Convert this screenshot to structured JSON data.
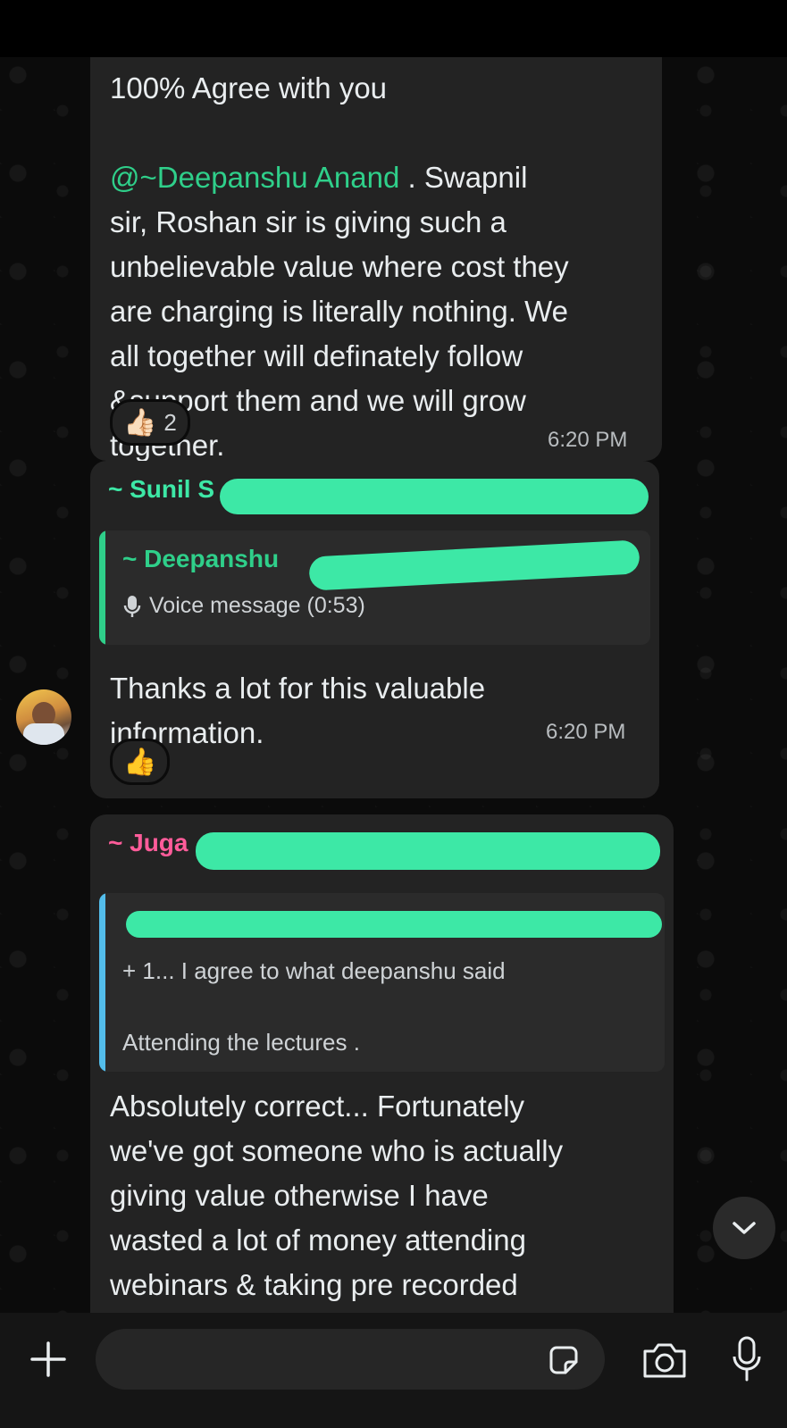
{
  "messages": [
    {
      "text_prefix": "100% Agree with you",
      "mention": "@~Deepanshu Anand",
      "text_after_mention": " . Swapnil",
      "text_rest": "sir, Roshan sir is giving such a\nunbelievable value where cost they\nare charging is literally nothing. We\nall together will definately follow\n&support them and we will grow\ntogether.",
      "time": "6:20 PM",
      "reaction": {
        "emoji": "👍🏻",
        "count": "2"
      }
    },
    {
      "sender": "~ Sunil S",
      "quote": {
        "author": "~ Deepanshu",
        "voice_label": "Voice message (0:53)"
      },
      "text": "Thanks a lot for this valuable\ninformation.",
      "time": "6:20 PM",
      "reaction": {
        "emoji": "👍"
      }
    },
    {
      "sender": "~ Juga",
      "quote": {
        "line1": "+ 1... I agree to what deepanshu said",
        "line2": "Attending the lectures ."
      },
      "text": "Absolutely correct... Fortunately\nwe've got someone who is actually\ngiving value otherwise I have\nwasted a lot of money attending\nwebinars & taking pre recorded"
    }
  ],
  "colors": {
    "sender1": "#3de8a6",
    "sender2": "#ff5c9a",
    "quote_bar_green": "#2fcf8a",
    "quote_bar_blue": "#53bdeb",
    "redaction": "#3de8a6"
  },
  "input": {
    "placeholder": ""
  },
  "icons": {
    "attach": "plus-icon",
    "sticker": "sticker-icon",
    "camera": "camera-icon",
    "mic": "microphone-icon",
    "scroll": "chevron-down-icon",
    "voice": "microphone-icon"
  }
}
